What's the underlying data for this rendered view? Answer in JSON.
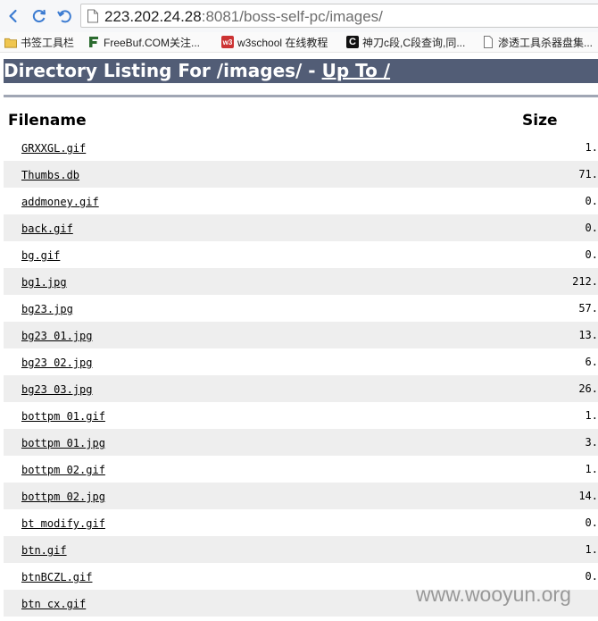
{
  "browser": {
    "url_host": "223.202.24.28",
    "url_rest": ":8081/boss-self-pc/images/",
    "bookmarks": [
      {
        "label": "书签工具栏",
        "icon": "folder-icon"
      },
      {
        "label": "FreeBuf.COM关注...",
        "icon": "freebuf-icon"
      },
      {
        "label": "w3school 在线教程",
        "icon": "w3school-icon"
      },
      {
        "label": "神刀c段,C段查询,同...",
        "icon": "c-icon"
      },
      {
        "label": "渗透工具杀器盘集...",
        "icon": "page-icon"
      }
    ]
  },
  "page": {
    "heading_prefix": "Directory Listing For /images/ - ",
    "heading_link": "Up To /",
    "col_filename": "Filename",
    "col_size": "Size",
    "files": [
      {
        "name": "GRXXGL.gif",
        "size": "1."
      },
      {
        "name": "Thumbs.db",
        "size": "71."
      },
      {
        "name": "addmoney.gif",
        "size": "0."
      },
      {
        "name": "back.gif",
        "size": "0."
      },
      {
        "name": "bg.gif",
        "size": "0."
      },
      {
        "name": "bg1.jpg",
        "size": "212."
      },
      {
        "name": "bg23.jpg",
        "size": "57."
      },
      {
        "name": "bg23 01.jpg",
        "size": "13."
      },
      {
        "name": "bg23 02.jpg",
        "size": "6."
      },
      {
        "name": "bg23 03.jpg",
        "size": "26."
      },
      {
        "name": "bottpm 01.gif",
        "size": "1."
      },
      {
        "name": "bottpm 01.jpg",
        "size": "3."
      },
      {
        "name": "bottpm 02.gif",
        "size": "1."
      },
      {
        "name": "bottpm 02.jpg",
        "size": "14."
      },
      {
        "name": "bt modify.gif",
        "size": "0."
      },
      {
        "name": "btn.gif",
        "size": "1."
      },
      {
        "name": "btnBCZL.gif",
        "size": "0."
      },
      {
        "name": "btn cx.gif",
        "size": ""
      }
    ]
  },
  "watermark": "www.wooyun.org"
}
